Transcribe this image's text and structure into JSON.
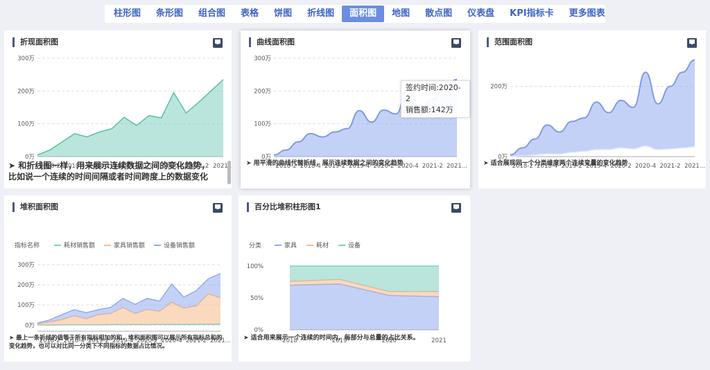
{
  "tabs": [
    "柱形图",
    "条形图",
    "组合图",
    "表格",
    "饼图",
    "折线图",
    "面积图",
    "地图",
    "散点图",
    "仪表盘",
    "KPI指标卡",
    "更多图表"
  ],
  "active_tab": "面积图",
  "cards": {
    "line_area": {
      "title": "折现面积图",
      "desc": "➤ 和折线图一样，用来展示连续数据之间的变化趋势，比如说一个连续的时间间隔或者时间跨度上的数据变化"
    },
    "curve_area": {
      "title": "曲线面积图",
      "desc": "➤ 用平滑的曲线代替折线，展示连续数据之间的变化趋势",
      "tooltip": {
        "line1": "签约时间:2020-2",
        "line2": "销售额:142万"
      }
    },
    "range_area": {
      "title": "范围面积图",
      "desc": "➤ 适合展现同一个分类维度两个连续变量的变化趋势"
    },
    "stacked_area": {
      "title": "堆积面积图",
      "legend_title": "指标名称",
      "desc": "➤ 最上一条折线的值等于所有指标相加的和，堆积面积图可以展示所有指标总和的变化趋势，也可以对比同一分类下不同指标的数据占比情况。"
    },
    "percent_area": {
      "title": "百分比堆积柱形图1",
      "legend_title": "分类",
      "desc": "➤ 适合用来展示一个连续的时间内，每部分与总量的占比关系。"
    }
  },
  "chart_data": [
    {
      "type": "area",
      "title": "折现面积图",
      "x": [
        "2018-1",
        "2018-2",
        "2018-3",
        "2018-4",
        "2019-1",
        "2019-2",
        "2019-3",
        "2019-4",
        "2020-1",
        "2020-2",
        "2020-3",
        "2020-4",
        "2021-1",
        "2021-2",
        "2021-3",
        "2021-4"
      ],
      "x_ticks": [
        "2018-2",
        "2018-4",
        "2019-2",
        "2019-4",
        "2020-2",
        "2020-4",
        "2021-2",
        "2021..."
      ],
      "y_ticks": [
        "0万",
        "100万",
        "200万",
        "300万"
      ],
      "ylim": [
        0,
        300
      ],
      "values": [
        5,
        20,
        45,
        70,
        60,
        75,
        85,
        120,
        95,
        125,
        118,
        195,
        133,
        165,
        200,
        235
      ],
      "color": "#7fd0c0"
    },
    {
      "type": "area",
      "title": "曲线面积图",
      "smooth": true,
      "x": [
        "2018-1",
        "2018-2",
        "2018-3",
        "2018-4",
        "2019-1",
        "2019-2",
        "2019-3",
        "2019-4",
        "2020-1",
        "2020-2",
        "2020-3",
        "2020-4",
        "2021-1",
        "2021-2",
        "2021-3",
        "2021-4"
      ],
      "x_ticks": [
        "2018-2",
        "2018-4",
        "2019-2",
        "2019-4",
        "2020-2",
        "2020-4",
        "2021-2",
        "2021..."
      ],
      "y_ticks": [
        "0万",
        "100万",
        "200万",
        "300万"
      ],
      "ylim": [
        0,
        300
      ],
      "values": [
        5,
        20,
        45,
        70,
        60,
        75,
        85,
        140,
        105,
        142,
        130,
        210,
        145,
        175,
        205,
        235
      ],
      "color": "#93acf0"
    },
    {
      "type": "area",
      "title": "范围面积图",
      "smooth": true,
      "x": [
        "2018-1",
        "2018-2",
        "2018-3",
        "2018-4",
        "2019-1",
        "2019-2",
        "2019-3",
        "2019-4",
        "2020-1",
        "2020-2",
        "2020-3",
        "2020-4",
        "2021-1",
        "2021-2",
        "2021-3",
        "2021-4"
      ],
      "x_ticks": [
        "2018-2",
        "2018-4",
        "2019-2",
        "2019-4",
        "2020-2",
        "2020-4",
        "2021-2",
        "2021..."
      ],
      "y_ticks": [
        "0万",
        "200万"
      ],
      "ylim": [
        0,
        280
      ],
      "upper": [
        5,
        25,
        50,
        90,
        70,
        100,
        110,
        155,
        125,
        160,
        140,
        240,
        150,
        200,
        240,
        275
      ],
      "lower": [
        0,
        2,
        5,
        8,
        7,
        12,
        15,
        20,
        20,
        25,
        22,
        30,
        20,
        22,
        25,
        28
      ],
      "color": "#93acf0"
    },
    {
      "type": "area",
      "title": "堆积面积图",
      "stacked": true,
      "x": [
        "2018-1",
        "2018-2",
        "2018-3",
        "2018-4",
        "2019-1",
        "2019-2",
        "2019-3",
        "2019-4",
        "2020-1",
        "2020-2",
        "2020-3",
        "2020-4",
        "2021-1",
        "2021-2",
        "2021-3",
        "2021-4"
      ],
      "x_ticks": [
        "2018-2",
        "2018-4",
        "2019-2",
        "2019-4",
        "2020-2",
        "2020-4",
        "2021-2",
        "2021..."
      ],
      "y_ticks": [
        "0万",
        "100万",
        "200万",
        "300万"
      ],
      "ylim": [
        -30,
        300
      ],
      "series": [
        {
          "name": "耗材销售额",
          "color": "#7fd0c0",
          "values": [
            1,
            1,
            2,
            2,
            2,
            2,
            3,
            3,
            3,
            3,
            4,
            4,
            4,
            5,
            5,
            6
          ]
        },
        {
          "name": "家具销售额",
          "color": "#f5b98a",
          "values": [
            5,
            15,
            25,
            45,
            30,
            50,
            55,
            85,
            55,
            75,
            65,
            110,
            80,
            90,
            150,
            130
          ]
        },
        {
          "name": "设备销售额",
          "color": "#93acf0",
          "values": [
            4,
            10,
            25,
            30,
            30,
            25,
            30,
            45,
            45,
            55,
            50,
            90,
            55,
            75,
            75,
            120
          ]
        }
      ]
    },
    {
      "type": "area",
      "title": "百分比堆积柱形图1",
      "stacked": "percent",
      "x": [
        "2018",
        "2019",
        "2020",
        "2021"
      ],
      "y_ticks": [
        "0%",
        "50%",
        "100%"
      ],
      "ylim": [
        0,
        100
      ],
      "series": [
        {
          "name": "家具",
          "color": "#93acf0",
          "values": [
            70,
            72,
            54,
            52
          ]
        },
        {
          "name": "耗材",
          "color": "#f5b98a",
          "values": [
            6,
            7,
            6,
            8
          ]
        },
        {
          "name": "设备",
          "color": "#7fd0c0",
          "values": [
            24,
            21,
            40,
            40
          ]
        }
      ]
    }
  ]
}
